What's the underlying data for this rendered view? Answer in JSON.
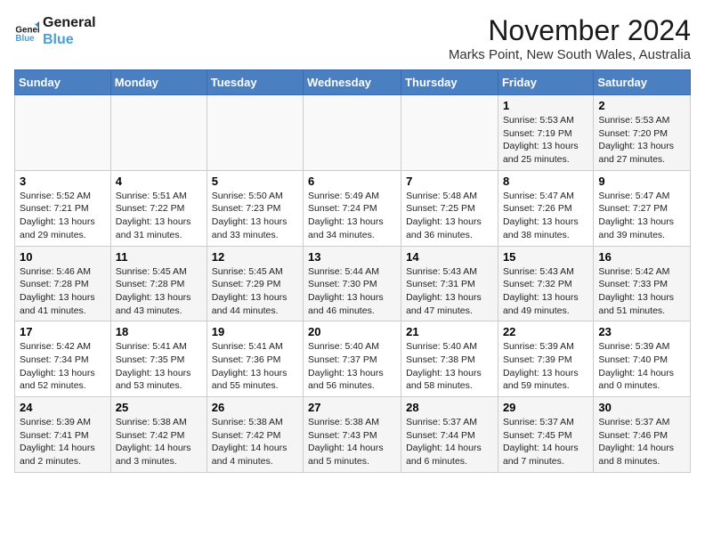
{
  "logo": {
    "line1": "General",
    "line2": "Blue"
  },
  "header": {
    "month": "November 2024",
    "location": "Marks Point, New South Wales, Australia"
  },
  "weekdays": [
    "Sunday",
    "Monday",
    "Tuesday",
    "Wednesday",
    "Thursday",
    "Friday",
    "Saturday"
  ],
  "weeks": [
    [
      {
        "day": "",
        "info": ""
      },
      {
        "day": "",
        "info": ""
      },
      {
        "day": "",
        "info": ""
      },
      {
        "day": "",
        "info": ""
      },
      {
        "day": "",
        "info": ""
      },
      {
        "day": "1",
        "info": "Sunrise: 5:53 AM\nSunset: 7:19 PM\nDaylight: 13 hours\nand 25 minutes."
      },
      {
        "day": "2",
        "info": "Sunrise: 5:53 AM\nSunset: 7:20 PM\nDaylight: 13 hours\nand 27 minutes."
      }
    ],
    [
      {
        "day": "3",
        "info": "Sunrise: 5:52 AM\nSunset: 7:21 PM\nDaylight: 13 hours\nand 29 minutes."
      },
      {
        "day": "4",
        "info": "Sunrise: 5:51 AM\nSunset: 7:22 PM\nDaylight: 13 hours\nand 31 minutes."
      },
      {
        "day": "5",
        "info": "Sunrise: 5:50 AM\nSunset: 7:23 PM\nDaylight: 13 hours\nand 33 minutes."
      },
      {
        "day": "6",
        "info": "Sunrise: 5:49 AM\nSunset: 7:24 PM\nDaylight: 13 hours\nand 34 minutes."
      },
      {
        "day": "7",
        "info": "Sunrise: 5:48 AM\nSunset: 7:25 PM\nDaylight: 13 hours\nand 36 minutes."
      },
      {
        "day": "8",
        "info": "Sunrise: 5:47 AM\nSunset: 7:26 PM\nDaylight: 13 hours\nand 38 minutes."
      },
      {
        "day": "9",
        "info": "Sunrise: 5:47 AM\nSunset: 7:27 PM\nDaylight: 13 hours\nand 39 minutes."
      }
    ],
    [
      {
        "day": "10",
        "info": "Sunrise: 5:46 AM\nSunset: 7:28 PM\nDaylight: 13 hours\nand 41 minutes."
      },
      {
        "day": "11",
        "info": "Sunrise: 5:45 AM\nSunset: 7:28 PM\nDaylight: 13 hours\nand 43 minutes."
      },
      {
        "day": "12",
        "info": "Sunrise: 5:45 AM\nSunset: 7:29 PM\nDaylight: 13 hours\nand 44 minutes."
      },
      {
        "day": "13",
        "info": "Sunrise: 5:44 AM\nSunset: 7:30 PM\nDaylight: 13 hours\nand 46 minutes."
      },
      {
        "day": "14",
        "info": "Sunrise: 5:43 AM\nSunset: 7:31 PM\nDaylight: 13 hours\nand 47 minutes."
      },
      {
        "day": "15",
        "info": "Sunrise: 5:43 AM\nSunset: 7:32 PM\nDaylight: 13 hours\nand 49 minutes."
      },
      {
        "day": "16",
        "info": "Sunrise: 5:42 AM\nSunset: 7:33 PM\nDaylight: 13 hours\nand 51 minutes."
      }
    ],
    [
      {
        "day": "17",
        "info": "Sunrise: 5:42 AM\nSunset: 7:34 PM\nDaylight: 13 hours\nand 52 minutes."
      },
      {
        "day": "18",
        "info": "Sunrise: 5:41 AM\nSunset: 7:35 PM\nDaylight: 13 hours\nand 53 minutes."
      },
      {
        "day": "19",
        "info": "Sunrise: 5:41 AM\nSunset: 7:36 PM\nDaylight: 13 hours\nand 55 minutes."
      },
      {
        "day": "20",
        "info": "Sunrise: 5:40 AM\nSunset: 7:37 PM\nDaylight: 13 hours\nand 56 minutes."
      },
      {
        "day": "21",
        "info": "Sunrise: 5:40 AM\nSunset: 7:38 PM\nDaylight: 13 hours\nand 58 minutes."
      },
      {
        "day": "22",
        "info": "Sunrise: 5:39 AM\nSunset: 7:39 PM\nDaylight: 13 hours\nand 59 minutes."
      },
      {
        "day": "23",
        "info": "Sunrise: 5:39 AM\nSunset: 7:40 PM\nDaylight: 14 hours\nand 0 minutes."
      }
    ],
    [
      {
        "day": "24",
        "info": "Sunrise: 5:39 AM\nSunset: 7:41 PM\nDaylight: 14 hours\nand 2 minutes."
      },
      {
        "day": "25",
        "info": "Sunrise: 5:38 AM\nSunset: 7:42 PM\nDaylight: 14 hours\nand 3 minutes."
      },
      {
        "day": "26",
        "info": "Sunrise: 5:38 AM\nSunset: 7:42 PM\nDaylight: 14 hours\nand 4 minutes."
      },
      {
        "day": "27",
        "info": "Sunrise: 5:38 AM\nSunset: 7:43 PM\nDaylight: 14 hours\nand 5 minutes."
      },
      {
        "day": "28",
        "info": "Sunrise: 5:37 AM\nSunset: 7:44 PM\nDaylight: 14 hours\nand 6 minutes."
      },
      {
        "day": "29",
        "info": "Sunrise: 5:37 AM\nSunset: 7:45 PM\nDaylight: 14 hours\nand 7 minutes."
      },
      {
        "day": "30",
        "info": "Sunrise: 5:37 AM\nSunset: 7:46 PM\nDaylight: 14 hours\nand 8 minutes."
      }
    ]
  ]
}
